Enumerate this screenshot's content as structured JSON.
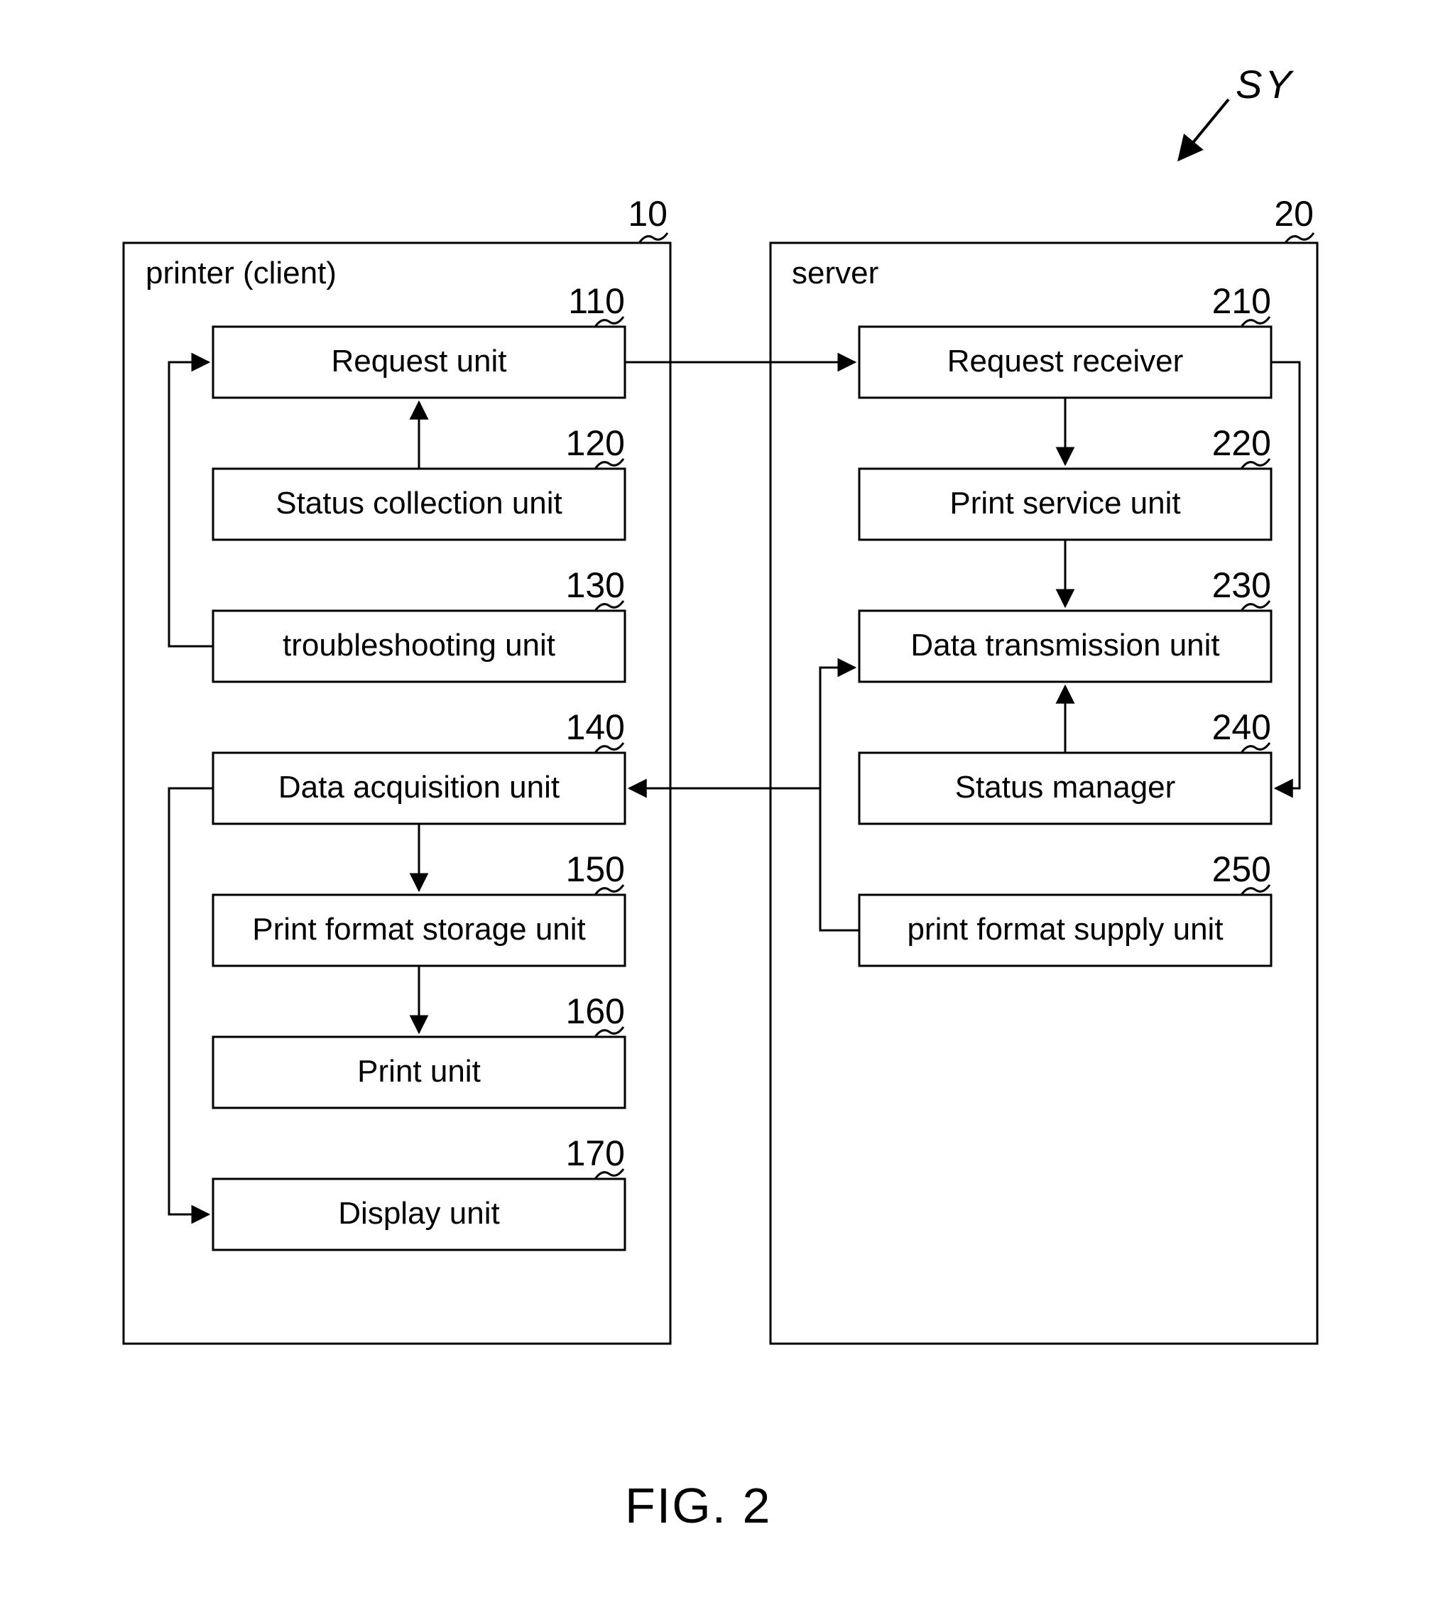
{
  "figure_label": "FIG. 2",
  "sy_label": "SY",
  "client": {
    "container_label": "printer (client)",
    "container_num": "10",
    "blocks": [
      {
        "id": "110",
        "label": "Request unit"
      },
      {
        "id": "120",
        "label": "Status collection unit"
      },
      {
        "id": "130",
        "label": "troubleshooting unit"
      },
      {
        "id": "140",
        "label": "Data acquisition unit"
      },
      {
        "id": "150",
        "label": "Print format storage unit"
      },
      {
        "id": "160",
        "label": "Print unit"
      },
      {
        "id": "170",
        "label": "Display unit"
      }
    ]
  },
  "server": {
    "container_label": "server",
    "container_num": "20",
    "blocks": [
      {
        "id": "210",
        "label": "Request receiver"
      },
      {
        "id": "220",
        "label": "Print service unit"
      },
      {
        "id": "230",
        "label": "Data transmission unit"
      },
      {
        "id": "240",
        "label": "Status manager"
      },
      {
        "id": "250",
        "label": "print format supply unit"
      }
    ]
  }
}
